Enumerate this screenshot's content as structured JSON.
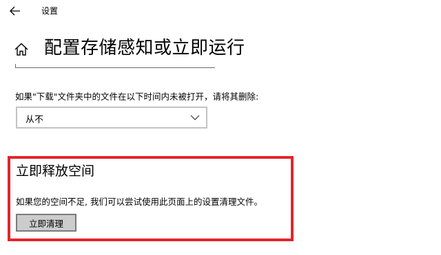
{
  "window": {
    "title": "设置"
  },
  "header": {
    "title": "配置存储感知或立即运行"
  },
  "downloads": {
    "label": "如果\"下载\"文件夹中的文件在以下时间内未被打开，请将其删除:",
    "selected_value": "从不"
  },
  "free_space": {
    "heading": "立即释放空间",
    "description": "如果您的空间不足, 我们可以尝试使用此页面上的设置清理文件。",
    "button_label": "立即清理"
  },
  "colors": {
    "highlight": "#e0262c",
    "button_bg": "#cccccc",
    "select_border": "#c3c3c3"
  },
  "icons": {
    "back": "back-arrow-icon",
    "home": "home-icon",
    "dropdown": "chevron-down-icon"
  }
}
